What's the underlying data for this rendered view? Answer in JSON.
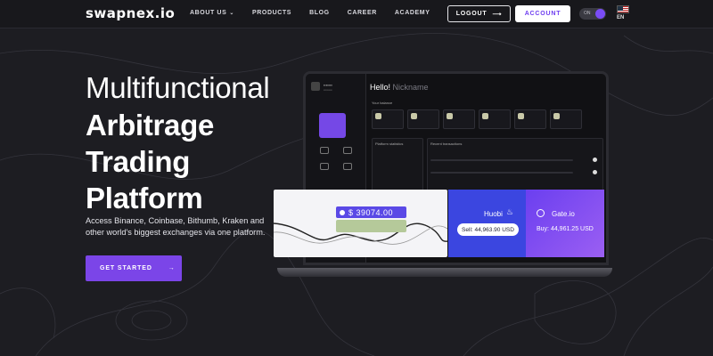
{
  "header": {
    "logo": "swapnex.io",
    "nav": [
      {
        "label": "ABOUT US",
        "has_dropdown": true
      },
      {
        "label": "PRODUCTS",
        "has_dropdown": false
      },
      {
        "label": "BLOG",
        "has_dropdown": false
      },
      {
        "label": "CAREER",
        "has_dropdown": false
      },
      {
        "label": "ACADEMY",
        "has_dropdown": false
      }
    ],
    "logout_label": "LOGOUT",
    "account_label": "ACCOUNT",
    "theme_toggle_label": "ON",
    "language": "EN",
    "chevron_glyph": "⌄",
    "arrow_glyph": "⟶"
  },
  "hero": {
    "line1": "Multifunctional",
    "line2": "Arbitrage",
    "line3": "Trading",
    "line4": "Platform",
    "subtitle": "Access Binance, Coinbase, Bithumb, Kraken and other world's biggest exchanges via one platform.",
    "cta_label": "GET STARTED",
    "cta_arrow": "→"
  },
  "dashboard": {
    "greeting": "Hello!",
    "greeting_name": "Nickname",
    "balance_section": "Your balance",
    "platform_section": "Platform statistics",
    "transactions_section": "Recent transactions"
  },
  "cards": {
    "price": "$ 39074.00",
    "huobi_name": "Huobi",
    "huobi_sell": "Sell: 44,963.90 USD",
    "gate_name": "Gate.io",
    "gate_buy": "Buy: 44,961.25 USD"
  },
  "colors": {
    "accent": "#7b45e8",
    "background": "#1d1d22",
    "huobi": "#3b46e0",
    "gate": "#7a4cf0"
  }
}
